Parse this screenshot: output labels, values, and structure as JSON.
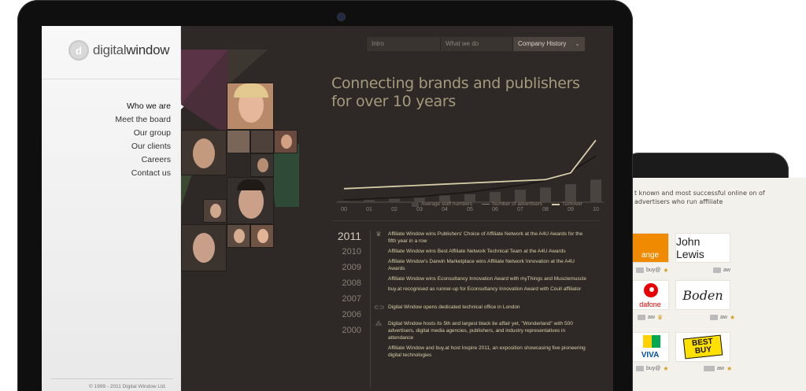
{
  "brand": {
    "logo_prefix": "digital",
    "logo_suffix": "window",
    "logo_mark": "d"
  },
  "sidebar": {
    "items": [
      {
        "label": "Who we are"
      },
      {
        "label": "Meet the board"
      },
      {
        "label": "Our group"
      },
      {
        "label": "Our clients"
      },
      {
        "label": "Careers"
      },
      {
        "label": "Contact us"
      }
    ],
    "copyright": "© 1999 - 2011 Digital Window Ltd."
  },
  "topnav": {
    "items": [
      {
        "label": "Intro"
      },
      {
        "label": "What we do"
      },
      {
        "label": "Company History"
      }
    ],
    "chevron": "⌄"
  },
  "headline": {
    "line1": "Connecting brands and publishers",
    "line2": "for over 10 years"
  },
  "chart_data": {
    "type": "bar",
    "categories": [
      "00",
      "01",
      "02",
      "03",
      "04",
      "05",
      "06",
      "07",
      "08",
      "09",
      "10"
    ],
    "series": [
      {
        "name": "Average staff numbers",
        "type": "bar",
        "values": [
          1,
          2,
          3,
          4,
          6,
          7,
          9,
          11,
          13,
          16,
          20
        ]
      },
      {
        "name": "Number of advertisers",
        "type": "line",
        "values": [
          2,
          3,
          4,
          5,
          7,
          9,
          12,
          15,
          19,
          27,
          41
        ]
      },
      {
        "name": "Turnover",
        "type": "line",
        "values": [
          12,
          13,
          14,
          15,
          16,
          17,
          18,
          19,
          20,
          26,
          55
        ]
      }
    ],
    "legend": [
      "Average staff numbers",
      "Number of advertisers",
      "Turnover"
    ],
    "colors": {
      "bars": "#4a4440",
      "advertisers": "#1a1614",
      "turnover": "#d6cda8"
    }
  },
  "timeline": {
    "years": [
      "2011",
      "2010",
      "2009",
      "2008",
      "2007",
      "2006",
      "2000"
    ],
    "events": [
      {
        "icon": "trophy-icon",
        "glyph": "🏆",
        "text": "Affiliate Window wins Publishers' Choice of Affiliate Network at the A4U Awards for the fifth year in a row"
      },
      {
        "icon": "blank",
        "glyph": "",
        "text": "Affiliate Window wins Best Affiliate Network Technical Team at the A4U Awards"
      },
      {
        "icon": "blank",
        "glyph": "",
        "text": "Affiliate Window's Darwin Marketplace wins Affiliate Network Innovation at the A4U Awards"
      },
      {
        "icon": "blank",
        "glyph": "",
        "text": "Affiliate Window wins Econsultancy Innovation Award with myThings and Musclemuscle"
      },
      {
        "icon": "blank",
        "glyph": "",
        "text": "buy.at recognised as runner-up for Econsultancy Innovation Award with Coull affiliator"
      },
      {
        "icon": "office-icon",
        "glyph": "◯",
        "text": "Digital Window opens dedicated technical office in London"
      },
      {
        "icon": "people-icon",
        "glyph": "👥",
        "text": "Digital Window hosts its 5th and largest black tie affair yet, \"Wonderland\" with 500 advertisers, digital media agencies, publishers, and industry representatives in attendance"
      },
      {
        "icon": "blank",
        "glyph": "",
        "text": "Affiliate Window and buy.at host Inspire 2011, an exposition showcasing five pioneering digital technologies"
      }
    ]
  },
  "tablet": {
    "intro": "t known and most successful online on of advertisers who run affiliate",
    "logos": [
      {
        "name": "orange",
        "label": "ange",
        "meta": "buy@"
      },
      {
        "name": "john-lewis",
        "label": "John Lewis",
        "meta": "aw"
      },
      {
        "name": "vodafone",
        "label": "dafone",
        "meta": "aw"
      },
      {
        "name": "boden",
        "label": "Boden",
        "meta": "aw"
      },
      {
        "name": "aviva",
        "label": "VIVA",
        "meta": "buy@"
      },
      {
        "name": "best-buy",
        "label": "BEST BUY",
        "meta": "aw"
      }
    ]
  }
}
